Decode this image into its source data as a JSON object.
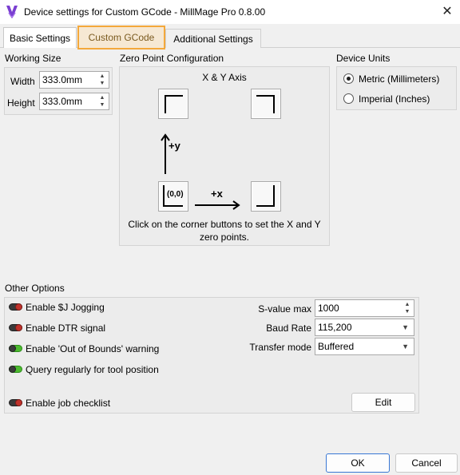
{
  "window": {
    "title": "Device settings for Custom GCode - MillMage Pro 0.8.00",
    "close_glyph": "✕"
  },
  "tabs": [
    {
      "label": "Basic Settings"
    },
    {
      "label": "Custom GCode"
    },
    {
      "label": "Additional Settings"
    }
  ],
  "working_size": {
    "heading": "Working Size",
    "width_label": "Width",
    "width_value": "333.0mm",
    "height_label": "Height",
    "height_value": "333.0mm"
  },
  "zero_point": {
    "heading": "Zero Point Configuration",
    "subheading": "X & Y Axis",
    "y_axis_label": "+y",
    "x_axis_label": "+x",
    "origin_label": "(0,0)",
    "instruction": "Click on the corner buttons to set the X and Y zero points."
  },
  "device_units": {
    "heading": "Device Units",
    "metric_label": "Metric (Millimeters)",
    "imperial_label": "Imperial (Inches)",
    "selected": "metric"
  },
  "other_options": {
    "heading": "Other Options",
    "toggles": [
      {
        "label": "Enable $J Jogging",
        "on": false
      },
      {
        "label": "Enable DTR signal",
        "on": false
      },
      {
        "label": "Enable 'Out of Bounds' warning",
        "on": true
      },
      {
        "label": "Query regularly for tool position",
        "on": true
      },
      {
        "label": "Enable job checklist",
        "on": false
      }
    ],
    "svalue_label": "S-value max",
    "svalue": "1000",
    "baud_label": "Baud Rate",
    "baud": "115,200",
    "transfer_label": "Transfer mode",
    "transfer": "Buffered",
    "edit_label": "Edit"
  },
  "footer": {
    "ok_label": "OK",
    "cancel_label": "Cancel"
  },
  "colors": {
    "tab_highlight": "#f4a83b",
    "toggle_on": "#4cbb2f",
    "toggle_off_knob": "#c0322b",
    "primary_border": "#3a78d4"
  }
}
